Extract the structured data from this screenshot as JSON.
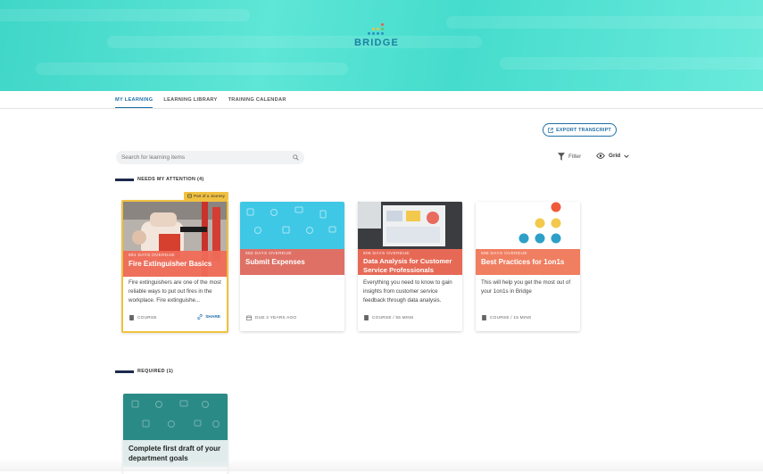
{
  "brand": {
    "logo_text": "BRIDGE"
  },
  "tabs": [
    {
      "label": "MY LEARNING",
      "active": true
    },
    {
      "label": "LEARNING LIBRARY",
      "active": false
    },
    {
      "label": "TRAINING CALENDAR",
      "active": false
    }
  ],
  "toolbar": {
    "export_label": "EXPORT TRANSCRIPT",
    "search_placeholder": "Search for learning items",
    "filter_label": "Filter",
    "view_label": "Grid"
  },
  "sections": {
    "attention": {
      "title": "NEEDS MY ATTENTION (4)"
    },
    "required": {
      "title": "REQUIRED (1)"
    }
  },
  "cards": [
    {
      "badge": "Part of a Journey",
      "status": "891 DAYS OVERDUE",
      "title": "Fire Extinguisher Basics",
      "description": "Fire extinguishers are one of the most reliable ways to put out fires in the workplace. Fire extinguishe...",
      "meta": "COURSE",
      "share_label": "SHARE",
      "overlay_color": "#ef6c57"
    },
    {
      "status": "882 DAYS OVERDUE",
      "title": "Submit Expenses",
      "description": "",
      "meta": "DUE 2 YEARS AGO",
      "overlay_color": "#e86b5e"
    },
    {
      "status": "806 DAYS OVERDUE",
      "title": "Data Analysis for Customer Service Professionals",
      "description": "Everything you need to know to gain insights from customer service feedback through data analysis.",
      "meta": "COURSE / 55 MINS",
      "overlay_color": "#ef6c57"
    },
    {
      "status": "698 DAYS OVERDUE",
      "title": "Best Practices for 1on1s",
      "description": "This will help you get the most out of your 1on1s in Bridge",
      "meta": "COURSE / 15 MINS",
      "overlay_color": "#f07a5c"
    }
  ],
  "required_cards": [
    {
      "title": "Complete first draft of your department goals"
    }
  ],
  "colors": {
    "accent": "#1f6fa8",
    "banner": "#45dccd",
    "journey": "#f0c040",
    "overdue": "#ef6c57"
  }
}
